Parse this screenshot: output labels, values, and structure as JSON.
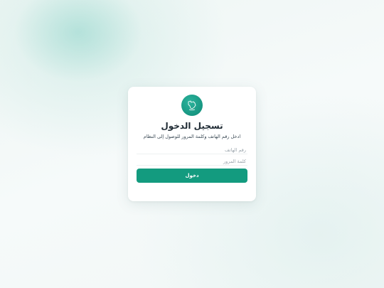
{
  "login": {
    "title": "تسجيل الدخول",
    "subtitle": "ادخل رقم الهاتف وكلمة المرور للوصول إلى النظام",
    "phone_placeholder": "رقم الهاتف",
    "password_placeholder": "كلمة المرور",
    "submit_label": "دخول"
  },
  "colors": {
    "accent": "#139b7f",
    "logo": "#0f8a76",
    "background": "#f2f7f6"
  },
  "icons": {
    "logo": "saudi-map-logo-icon"
  }
}
